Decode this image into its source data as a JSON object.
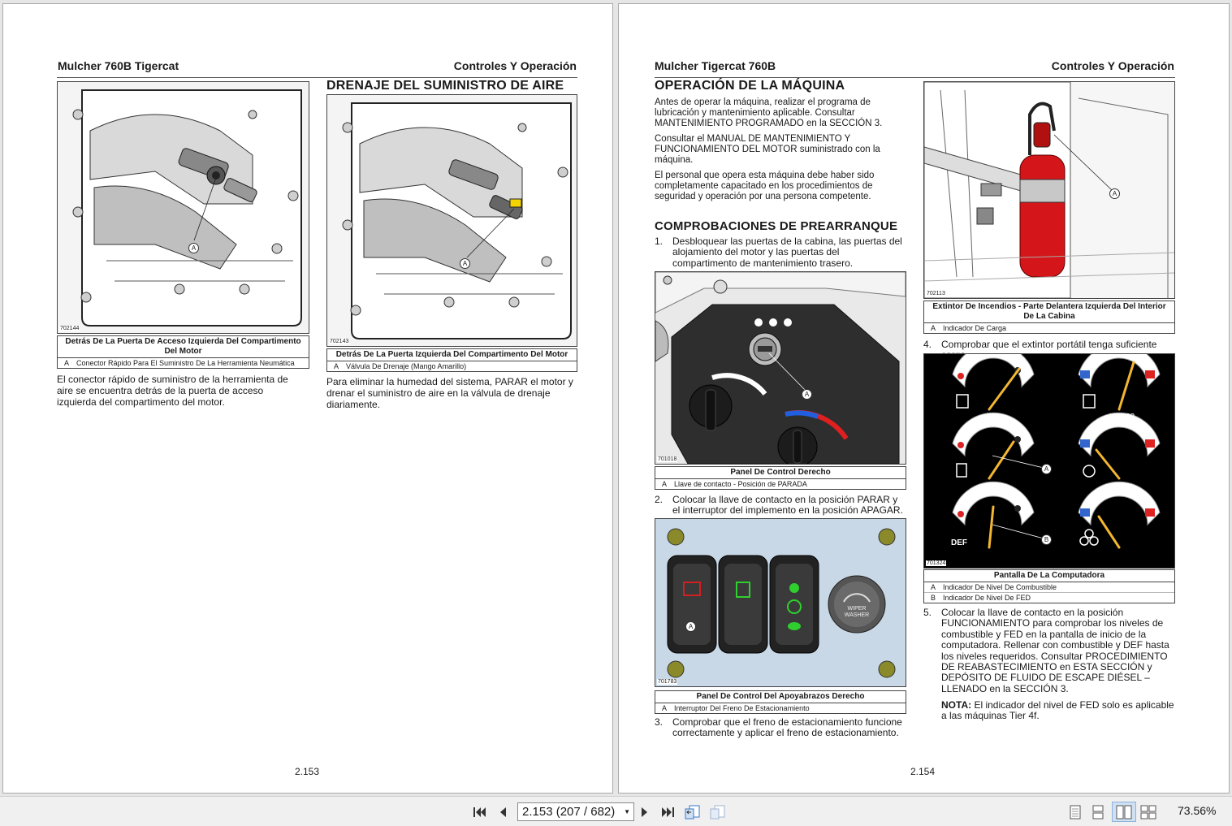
{
  "left_page": {
    "header_left": "Mulcher 760B Tigercat",
    "header_right": "Controles Y Operación",
    "page_number": "2.153",
    "figure1": {
      "id": "702144",
      "callout": "A",
      "caption_title": "Detrás De La Puerta De Acceso Izquierda Del Compartimento Del Motor",
      "caption_items": [
        {
          "label": "A",
          "text": "Conector Rápido Para El Suministro De La Herramienta Neumática"
        }
      ],
      "body": "El conector rápido de suministro de la herramienta de aire se encuentra detrás de la puerta de acceso izquierda del compartimento del motor."
    },
    "section_title": "DRENAJE DEL SUMINISTRO DE AIRE",
    "figure2": {
      "id": "702143",
      "callout": "A",
      "caption_title": "Detrás De La Puerta Izquierda Del Compartimento Del Motor",
      "caption_items": [
        {
          "label": "A",
          "text": "Válvula De Drenaje (Mango Amarillo)"
        }
      ],
      "body": "Para eliminar la humedad del sistema, PARAR el motor y drenar el suministro de aire en la válvula de drenaje diariamente."
    }
  },
  "right_page": {
    "header_left": "Mulcher Tigercat 760B",
    "header_right": "Controles Y Operación",
    "page_number": "2.154",
    "section1_title": "OPERACIÓN DE LA MÁQUINA",
    "section1_paragraphs": [
      "Antes de operar la máquina, realizar el programa de lubricación y mantenimiento aplicable. Consultar MANTENIMIENTO PROGRAMADO en la SECCIÓN 3.",
      "Consultar el MANUAL DE MANTENIMIENTO Y FUNCIONAMIENTO DEL MOTOR suministrado con la máquina.",
      "El personal que opera esta máquina debe haber sido completamente capacitado en los procedimientos de seguridad y operación por una persona competente."
    ],
    "section2_title": "COMPROBACIONES DE PREARRANQUE",
    "steps": [
      {
        "n": "1.",
        "text": "Desbloquear las puertas de la cabina, las puertas del alojamiento del motor y las puertas del compartimento de mantenimiento trasero."
      },
      {
        "n": "2.",
        "text": "Colocar la llave de contacto en la posición PARAR y el interruptor del implemento en la posición APAGAR."
      },
      {
        "n": "3.",
        "text": "Comprobar que el freno de estacionamiento funcione correctamente y aplicar el freno de estacionamiento."
      },
      {
        "n": "4.",
        "text": "Comprobar que el extintor portátil tenga suficiente carga."
      },
      {
        "n": "5.",
        "text": "Colocar la llave de contacto en la posición FUNCIONAMIENTO para comprobar los niveles de combustible y FED en la pantalla de inicio de la computadora. Rellenar con combustible y DEF hasta los niveles requeridos. Consultar PROCEDIMIENTO DE REABASTECIMIENTO en ESTA SECCIÓN y DEPÓSITO DE FLUIDO DE ESCAPE DIÉSEL – LLENADO en la SECCIÓN 3."
      }
    ],
    "note_label": "NOTA:",
    "note_text": "El indicador del nivel de FED solo es aplicable a las máquinas Tier 4f.",
    "fig_panel": {
      "id": "701018",
      "callout": "A",
      "caption_title": "Panel De Control Derecho",
      "caption_items": [
        {
          "label": "A",
          "text": "Llave de contacto - Posición de PARADA"
        }
      ]
    },
    "fig_armrest": {
      "id": "701783",
      "callout": "A",
      "wiper_label_1": "WIPER",
      "wiper_label_2": "WASHER",
      "caption_title": "Panel De Control Del Apoyabrazos Derecho",
      "caption_items": [
        {
          "label": "A",
          "text": "Interruptor Del Freno De Estacionamiento"
        }
      ]
    },
    "fig_extinguisher": {
      "id": "702113",
      "callout": "A",
      "caption_title": "Extintor De Incendios - Parte Delantera Izquierda Del Interior De La Cabina",
      "caption_items": [
        {
          "label": "A",
          "text": "Indicador De Carga"
        }
      ]
    },
    "fig_display": {
      "id": "701324",
      "iso_label": "ISO 22",
      "def_label": "DEF",
      "callout_a": "A",
      "callout_b": "B",
      "caption_title": "Pantalla De La Computadora",
      "caption_items": [
        {
          "label": "A",
          "text": "Indicador De Nivel De Combustible"
        },
        {
          "label": "B",
          "text": "Indicador De Nivel De FED"
        }
      ]
    }
  },
  "toolbar": {
    "page_display": "2.153 (207 / 682)",
    "zoom": "73.56%"
  }
}
